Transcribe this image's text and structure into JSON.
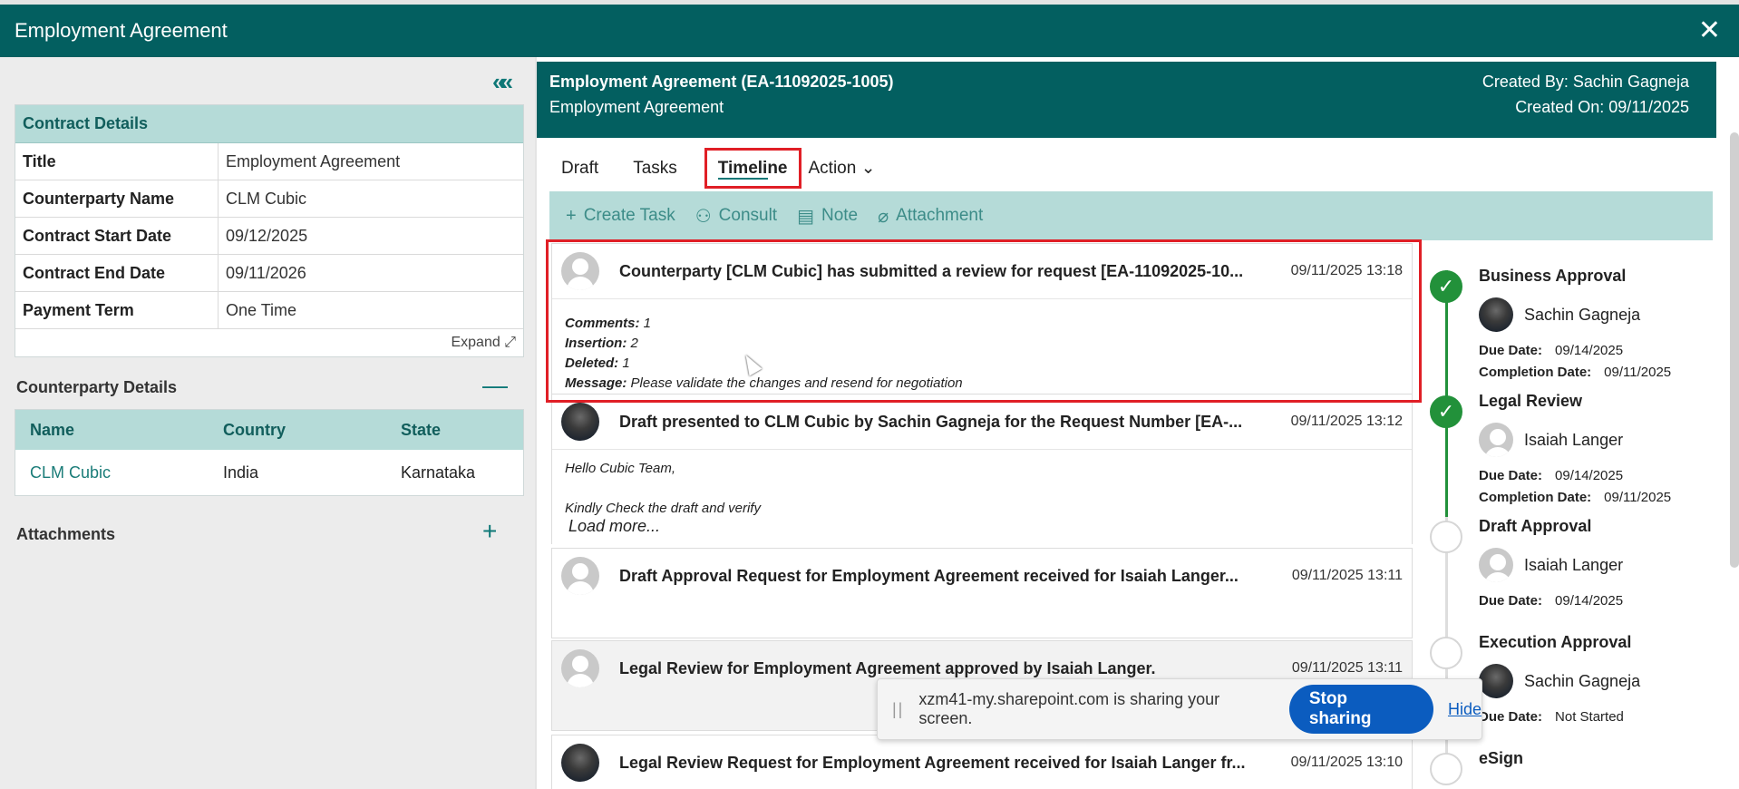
{
  "window": {
    "title": "Employment Agreement",
    "close": "✕"
  },
  "left": {
    "collapse": "«",
    "contract": {
      "header": "Contract Details",
      "rows": [
        {
          "k": "Title",
          "v": "Employment Agreement"
        },
        {
          "k": "Counterparty Name",
          "v": "CLM Cubic"
        },
        {
          "k": "Contract Start Date",
          "v": "09/12/2025"
        },
        {
          "k": "Contract End Date",
          "v": "09/11/2026"
        },
        {
          "k": "Payment Term",
          "v": "One Time"
        }
      ],
      "expand": "Expand ⤢"
    },
    "counterparty": {
      "title": "Counterparty Details",
      "toggle": "—",
      "cols": [
        "Name",
        "Country",
        "State"
      ],
      "row": [
        "CLM Cubic",
        "India",
        "Karnataka"
      ]
    },
    "attachments": {
      "title": "Attachments",
      "add": "+"
    }
  },
  "header": {
    "title": "Employment Agreement (EA-11092025-1005)",
    "subtitle": "Employment Agreement",
    "created_by": "Created By: Sachin Gagneja",
    "created_on": "Created On: 09/11/2025"
  },
  "tabs": [
    "Draft",
    "Tasks",
    "Timeline",
    "Action"
  ],
  "action_caret": "⌄",
  "toolbar": [
    {
      "icon": "+",
      "label": "Create Task"
    },
    {
      "icon": "⚇",
      "label": "Consult"
    },
    {
      "icon": "▤",
      "label": "Note"
    },
    {
      "icon": "⌀",
      "label": "Attachment"
    }
  ],
  "timeline": [
    {
      "title": "Counterparty [CLM Cubic] has submitted a review for request [EA-11092025-10...",
      "time": "09/11/2025 13:18",
      "lines": [
        {
          "k": "Comments:",
          "v": " 1"
        },
        {
          "k": "Insertion:",
          "v": " 2"
        },
        {
          "k": "Deleted:",
          "v": " 1"
        },
        {
          "k": "Message:",
          "v": " Please validate the changes and resend for negotiation"
        }
      ]
    },
    {
      "title": "Draft presented to CLM Cubic by Sachin Gagneja for the Request Number [EA-...",
      "time": "09/11/2025 13:12",
      "body1": "Hello Cubic Team,",
      "body2": "Kindly Check the draft and verify",
      "load_more": "Load more..."
    },
    {
      "title": "Draft Approval Request for Employment Agreement received for Isaiah Langer...",
      "time": "09/11/2025 13:11"
    },
    {
      "title": "Legal Review for Employment Agreement approved by Isaiah Langer.",
      "time": "09/11/2025 13:11"
    },
    {
      "title": "Legal Review Request for Employment Agreement received for Isaiah Langer fr...",
      "time": "09/11/2025 13:10"
    }
  ],
  "approvals": {
    "due_label": "Due Date:",
    "completion_label": "Completion Date:",
    "steps": [
      {
        "name": "Business Approval",
        "user": "Sachin Gagneja",
        "due": "09/14/2025",
        "completed": "09/11/2025",
        "status": "done"
      },
      {
        "name": "Legal Review",
        "user": "Isaiah Langer",
        "due": "09/14/2025",
        "completed": "09/11/2025",
        "status": "done"
      },
      {
        "name": "Draft Approval",
        "user": "Isaiah Langer",
        "due": "09/14/2025",
        "status": "pending"
      },
      {
        "name": "Execution Approval",
        "user": "Sachin Gagneja",
        "due": "Not Started",
        "status": "pending"
      },
      {
        "name": "eSign",
        "status": "pending"
      }
    ],
    "check": "✓"
  },
  "share": {
    "grip": "||",
    "text": "xzm41-my.sharepoint.com is sharing your screen.",
    "stop": "Stop sharing",
    "hide": "Hide"
  }
}
